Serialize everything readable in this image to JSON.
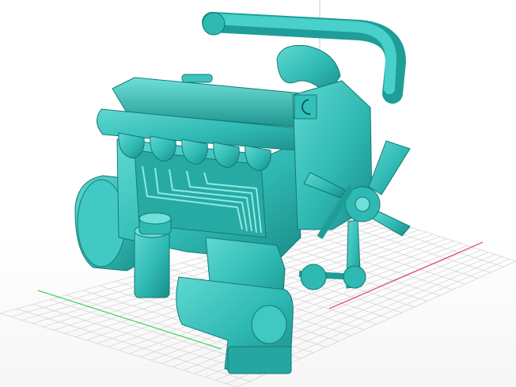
{
  "viewport": {
    "background": "#ffffff",
    "grid_color": "#d6d6d6",
    "axis_x_color": "#e0405a",
    "axis_y_color": "#39d65a",
    "axis_z_color": "#c8c8c8"
  },
  "model": {
    "color": "#2fb9b3",
    "shadow_color": "#1b8c88",
    "highlight_color": "#6fe0da",
    "selected": false
  }
}
